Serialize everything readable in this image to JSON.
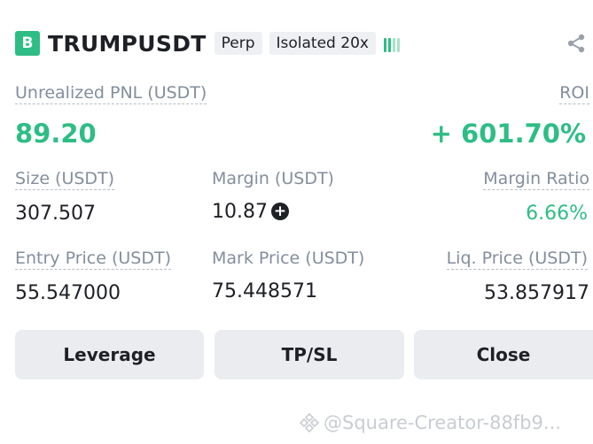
{
  "header": {
    "side_badge": "B",
    "symbol": "TRUMPUSDT",
    "contract_type": "Perp",
    "margin_mode": "Isolated 20x",
    "share_icon": "share-icon",
    "signal_icon": "adl-indicator-icon"
  },
  "pnl": {
    "label": "Unrealized PNL (USDT)",
    "value": "89.20",
    "roi_label": "ROI",
    "roi_value": "+ 601.70%"
  },
  "stats": {
    "size_label": "Size (USDT)",
    "size_value": "307.507",
    "margin_label": "Margin (USDT)",
    "margin_value": "10.87",
    "margin_ratio_label": "Margin Ratio",
    "margin_ratio_value": "6.66%",
    "entry_label": "Entry Price (USDT)",
    "entry_value": "55.547000",
    "mark_label": "Mark Price (USDT)",
    "mark_value": "75.448571",
    "liq_label": "Liq. Price (USDT)",
    "liq_value": "53.857917"
  },
  "actions": {
    "leverage": "Leverage",
    "tpsl": "TP/SL",
    "close": "Close"
  },
  "watermark": "@Square-Creator-88fb9...",
  "colors": {
    "positive": "#2ebd85",
    "text": "#1e2026",
    "muted": "#848e9c",
    "button_bg": "#eaecef"
  }
}
